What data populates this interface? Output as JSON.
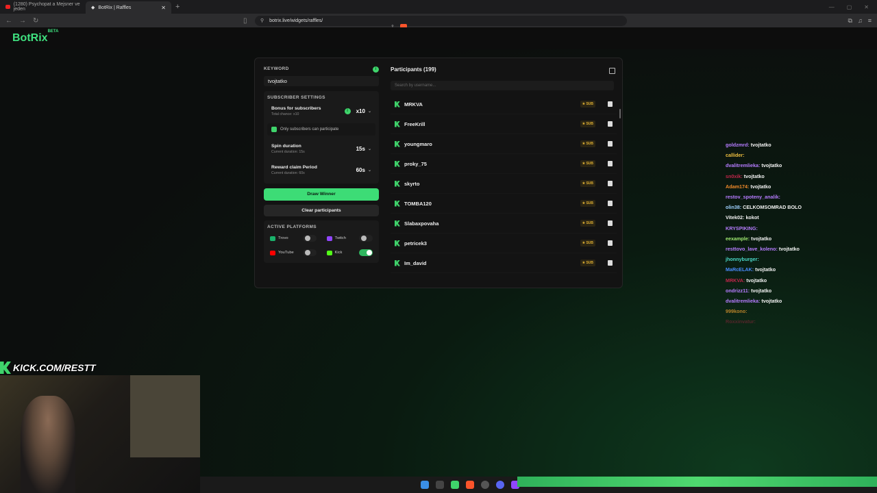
{
  "browser": {
    "tabs": [
      {
        "label": "(1280) Psychopat a Mejsner ve jeden"
      },
      {
        "label": "BotRix | Raffles"
      }
    ],
    "url": "botrix.live/widgets/raffles/"
  },
  "header": {
    "logo": "BotRix",
    "logo_badge": "BETA"
  },
  "raffle": {
    "keyword_label": "KEYWORD",
    "keyword_value": "tvojtatko",
    "subscriber_settings_label": "SUBSCRIBER SETTINGS",
    "bonus": {
      "title": "Bonus for subscribers",
      "subtitle": "Total chance: x10",
      "value": "x10"
    },
    "only_subs_label": "Only subscribers can participate",
    "spin": {
      "title": "Spin duration",
      "subtitle": "Current duration: 15s",
      "value": "15s"
    },
    "claim": {
      "title": "Reward claim Period",
      "subtitle": "Current duration: 60s",
      "value": "60s"
    },
    "draw_button": "Draw Winner",
    "clear_button": "Clear participants",
    "platforms_label": "ACTIVE PLATFORMS",
    "platforms": [
      {
        "name": "Trovo",
        "enabled": false,
        "color": "#1ab26b"
      },
      {
        "name": "Twitch",
        "enabled": false,
        "color": "#9146ff"
      },
      {
        "name": "YouTube",
        "enabled": false,
        "color": "#ff0000"
      },
      {
        "name": "Kick",
        "enabled": true,
        "color": "#53fc18"
      }
    ]
  },
  "participants": {
    "title": "Participants (199)",
    "search_placeholder": "Search by username...",
    "sub_badge": "SUB",
    "items": [
      {
        "name": "MRKVA"
      },
      {
        "name": "FreeKrill"
      },
      {
        "name": "youngmaro"
      },
      {
        "name": "proky_75"
      },
      {
        "name": "skyrto"
      },
      {
        "name": "TOMBA120"
      },
      {
        "name": "Slabaxpovaha"
      },
      {
        "name": "petricek3"
      },
      {
        "name": "Im_david"
      }
    ]
  },
  "chat": [
    {
      "user": "goldzmrd:",
      "msg": "tvojtatko",
      "color": "#b67cff"
    },
    {
      "user": "callider:",
      "msg": "",
      "color": "#f0c040"
    },
    {
      "user": "dvalitremlieka:",
      "msg": "tvojtatko",
      "color": "#b67cff"
    },
    {
      "user": "sn0xik:",
      "msg": "tvojtatko",
      "color": "#c0264a"
    },
    {
      "user": "Adam174:",
      "msg": "tvojtatko",
      "color": "#f08a2a"
    },
    {
      "user": "restov_spoteny_analik:",
      "msg": "",
      "color": "#b67cff"
    },
    {
      "user": "olin38:",
      "msg": "CELKOMSOMRAD BOLO",
      "color": "#9fd0ff"
    },
    {
      "user": "Vitek02:",
      "msg": "kokot",
      "color": "#f2f2f2"
    },
    {
      "user": "KRYSPIKING:",
      "msg": "",
      "color": "#b67cff"
    },
    {
      "user": "eexample:",
      "msg": "tvojtatko",
      "color": "#9fe870"
    },
    {
      "user": "resttovo_lave_koleno:",
      "msg": "tvojtatko",
      "color": "#b67cff"
    },
    {
      "user": "jhonnyburger:",
      "msg": "",
      "color": "#4ad9c9"
    },
    {
      "user": "MaRcELAK:",
      "msg": "tvojtatko",
      "color": "#4a8cff"
    },
    {
      "user": "MRKVA:",
      "msg": "tvojtatko",
      "color": "#c0264a"
    },
    {
      "user": "ondrizz11:",
      "msg": "tvojtatko",
      "color": "#b67cff"
    },
    {
      "user": "dvalitremlieka:",
      "msg": "tvojtatko",
      "color": "#b67cff"
    },
    {
      "user": "999kono:",
      "msg": "",
      "color": "#f0a030"
    },
    {
      "user": "Roxxinvatur:",
      "msg": "",
      "color": "#c0264a"
    }
  ],
  "stream": {
    "banner": "KICK.COM/RESTT"
  }
}
